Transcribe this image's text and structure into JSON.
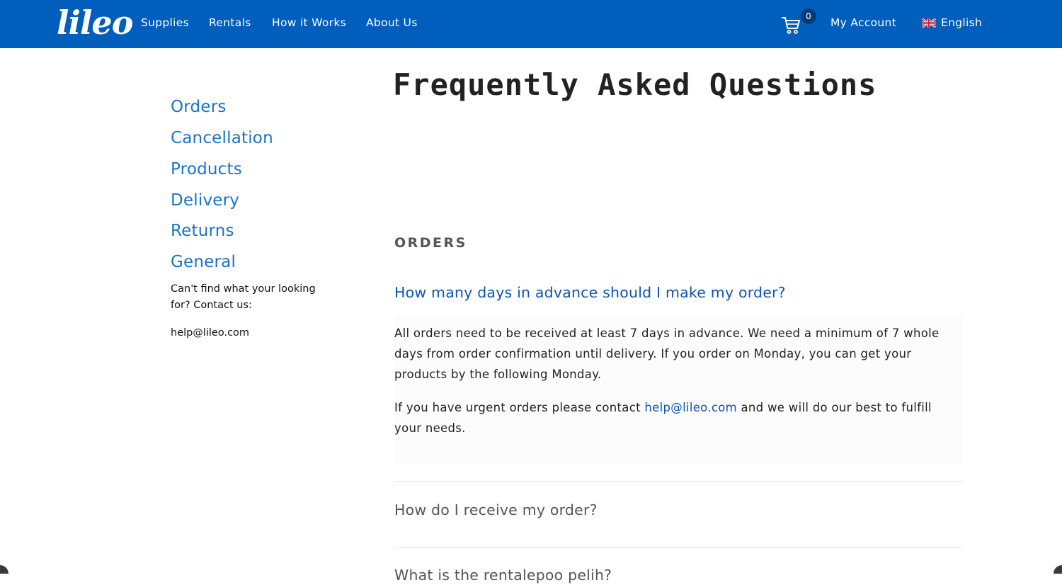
{
  "header": {
    "logo": "lileo",
    "nav": [
      "Supplies",
      "Rentals",
      "How it Works",
      "About Us"
    ],
    "cart_count": "0",
    "account_label": "My Account",
    "language_label": "English",
    "brand_color": "#005ebd"
  },
  "sidebar": {
    "links": [
      "Orders",
      "Cancellation",
      "Products",
      "Delivery",
      "Returns",
      "General"
    ],
    "contact_prompt": "Can't find what your looking for? Contact us:",
    "contact_email": "help@lileo.com"
  },
  "main": {
    "title": "Frequently Asked Questions",
    "section_heading": "ORDERS",
    "faq": [
      {
        "question": "How many days in advance should I make my order?",
        "answer_1": "All orders need to be received at least 7 days in advance. We need a minimum of 7 whole days from order confirmation until delivery. If you order on Monday, you can get your products by the following Monday.",
        "answer_2_before": "If you have urgent orders please contact ",
        "answer_2_link": "help@lileo.com",
        "answer_2_after": " and we will do our best to fulfill your needs."
      },
      {
        "question": "How do I receive my order?"
      },
      {
        "question": "What is the rentalepoo pelih?"
      }
    ]
  },
  "icons": {
    "cart": "shopping-cart-icon",
    "flag": "uk-flag-icon"
  }
}
